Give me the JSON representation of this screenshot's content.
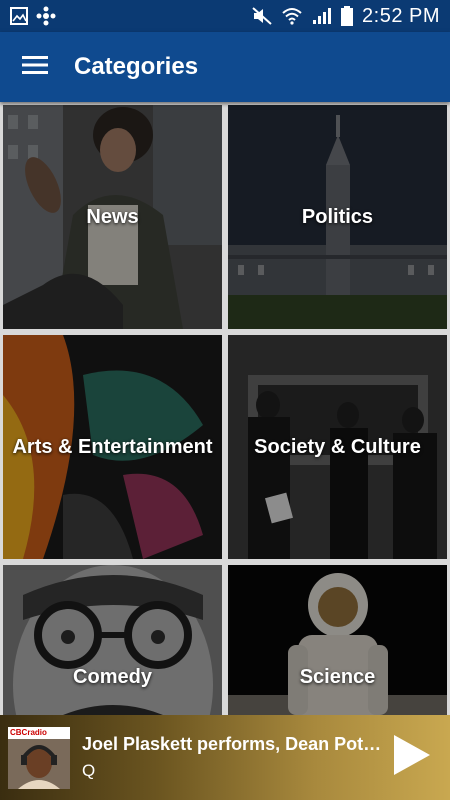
{
  "status_bar": {
    "time": "2:52 PM",
    "icons": [
      "image-icon",
      "cbc-gem-icon",
      "mute-icon",
      "wifi-icon",
      "signal-icon",
      "battery-icon"
    ]
  },
  "app_bar": {
    "title": "Categories",
    "menu_icon": "hamburger-menu-icon",
    "color": "#0f4a8f"
  },
  "categories": [
    {
      "label": "News"
    },
    {
      "label": "Politics"
    },
    {
      "label": "Arts & Entertainment"
    },
    {
      "label": "Society & Culture"
    },
    {
      "label": "Comedy"
    },
    {
      "label": "Science"
    }
  ],
  "now_playing": {
    "brand": "CBCradio",
    "title": "Joel Plaskett performs, Dean Potter...",
    "show": "Q",
    "play_icon": "play-icon"
  }
}
